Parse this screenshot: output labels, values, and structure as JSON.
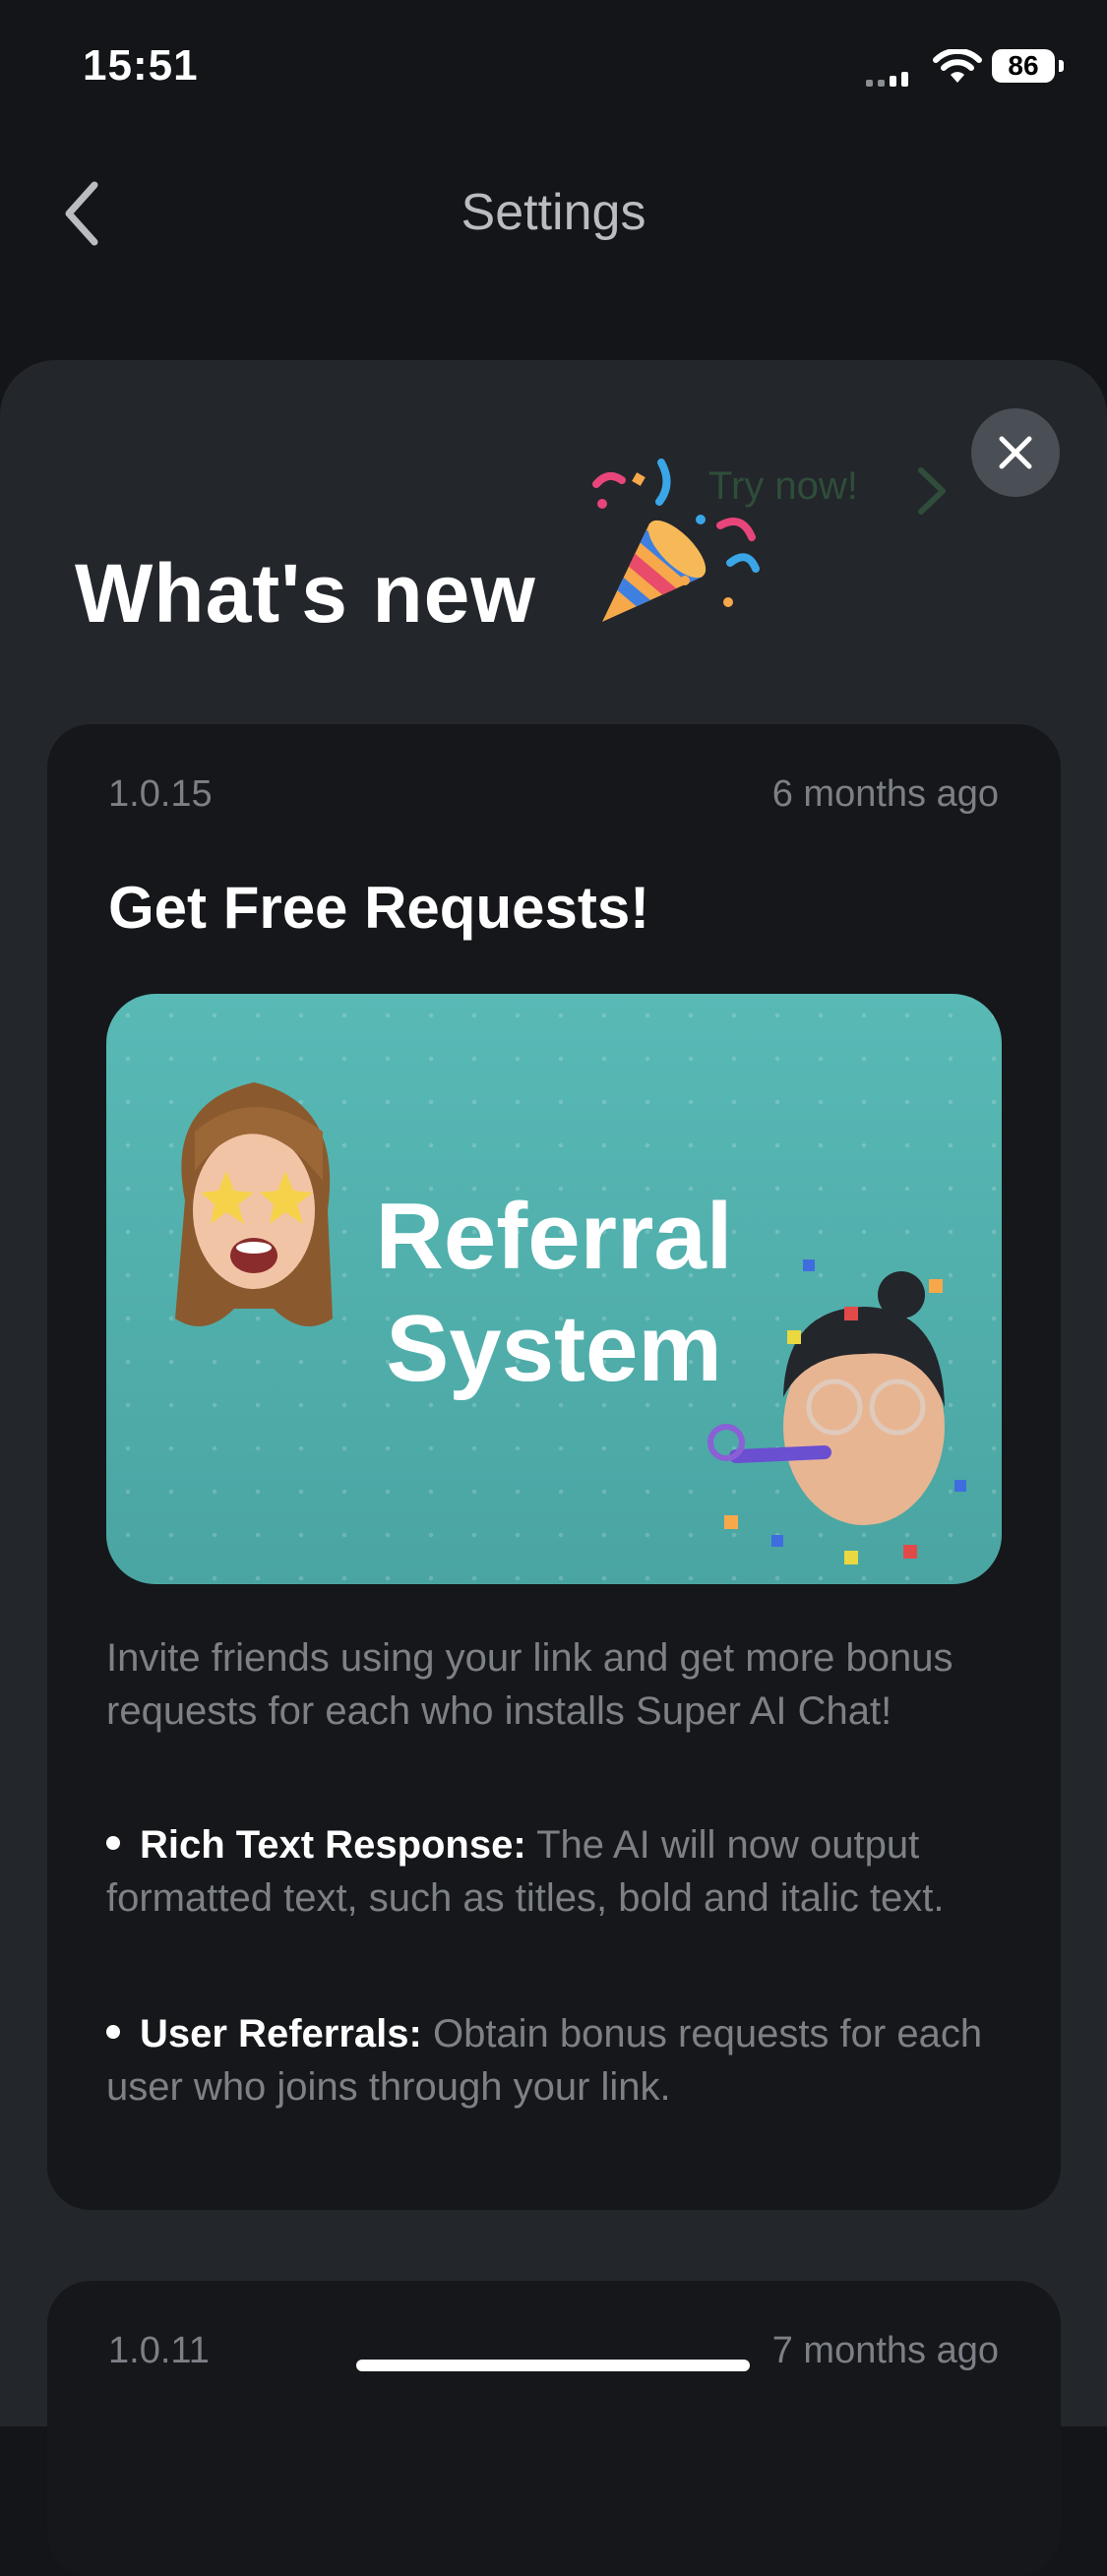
{
  "status": {
    "time": "15:51",
    "battery": "86"
  },
  "header": {
    "title": "Settings"
  },
  "whats_new": {
    "title": "What's new",
    "try_now": "Try now!"
  },
  "entries": [
    {
      "version": "1.0.15",
      "age": "6 months ago",
      "heading": "Get Free Requests!",
      "banner_title_line1": "Referral",
      "banner_title_line2": "System",
      "description": "Invite friends using your link and get more bonus requests for each who installs Super AI Chat!",
      "bullets": [
        {
          "label": "Rich Text Response:",
          "text": "The AI will now output formatted text, such as titles, bold and italic text."
        },
        {
          "label": "User Referrals:",
          "text": "Obtain bonus requests for each user who joins through your link."
        }
      ]
    },
    {
      "version": "1.0.11",
      "age": "7 months ago"
    }
  ]
}
